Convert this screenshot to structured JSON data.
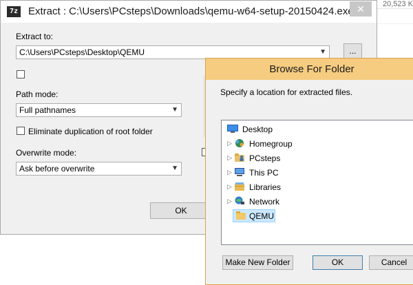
{
  "background": {
    "size_text": "20,523 K"
  },
  "extract": {
    "title": "Extract : C:\\Users\\PCsteps\\Downloads\\qemu-w64-setup-20150424.exe",
    "app_icon_text": "7z",
    "close_glyph": "✕",
    "extract_to_label": "Extract to:",
    "extract_to_value": "C:\\Users\\PCsteps\\Desktop\\QEMU",
    "browse_button_label": "...",
    "path_mode_label": "Path mode:",
    "path_mode_value": "Full pathnames",
    "eliminate_dup_label": "Eliminate duplication of root folder",
    "overwrite_mode_label": "Overwrite mode:",
    "overwrite_mode_value": "Ask before overwrite",
    "ok_label": "OK"
  },
  "browse": {
    "title": "Browse For Folder",
    "instruction": "Specify a location for extracted files.",
    "tree": [
      {
        "label": "Desktop",
        "icon": "desktop-icon",
        "expandable": false
      },
      {
        "label": "Homegroup",
        "icon": "homegroup-icon",
        "expandable": true
      },
      {
        "label": "PCsteps",
        "icon": "user-folder-icon",
        "expandable": true
      },
      {
        "label": "This PC",
        "icon": "computer-icon",
        "expandable": true
      },
      {
        "label": "Libraries",
        "icon": "libraries-icon",
        "expandable": true
      },
      {
        "label": "Network",
        "icon": "network-icon",
        "expandable": true
      },
      {
        "label": "QEMU",
        "icon": "folder-icon",
        "expandable": false,
        "selected": true
      }
    ],
    "make_new_folder_label": "Make New Folder",
    "ok_label": "OK",
    "cancel_label": "Cancel"
  }
}
